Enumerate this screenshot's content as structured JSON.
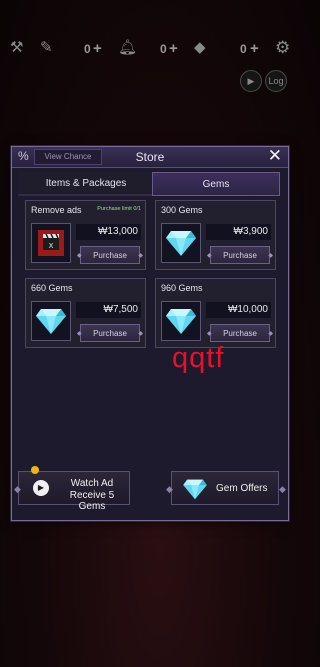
{
  "hud": {
    "count1": "0",
    "count2": "0",
    "count3": "0",
    "log_label": "Log"
  },
  "store": {
    "title": "Store",
    "percent_symbol": "%",
    "view_chance": "View Chance",
    "close_symbol": "✕",
    "tabs": [
      {
        "label": "Items & Packages",
        "active": false
      },
      {
        "label": "Gems",
        "active": true
      }
    ],
    "products": [
      {
        "name": "Remove ads",
        "badge": "Purchase limit 0/1",
        "price": "₩13,000",
        "button": "Purchase",
        "icon": "clapperboard-icon"
      },
      {
        "name": "300 Gems",
        "badge": "",
        "price": "₩3,900",
        "button": "Purchase",
        "icon": "diamond-icon"
      },
      {
        "name": "660 Gems",
        "badge": "",
        "price": "₩7,500",
        "button": "Purchase",
        "icon": "diamond-icon"
      },
      {
        "name": "960 Gems",
        "badge": "",
        "price": "₩10,000",
        "button": "Purchase",
        "icon": "diamond-icon"
      }
    ],
    "watch_ad": {
      "line1": "Watch Ad",
      "line2": "Receive 5 Gems"
    },
    "gem_offers": "Gem Offers"
  },
  "overlay_text": "qqtf",
  "colors": {
    "accent": "#7b6b96",
    "watermark": "#e8102a",
    "notification_dot": "#f2b316"
  }
}
